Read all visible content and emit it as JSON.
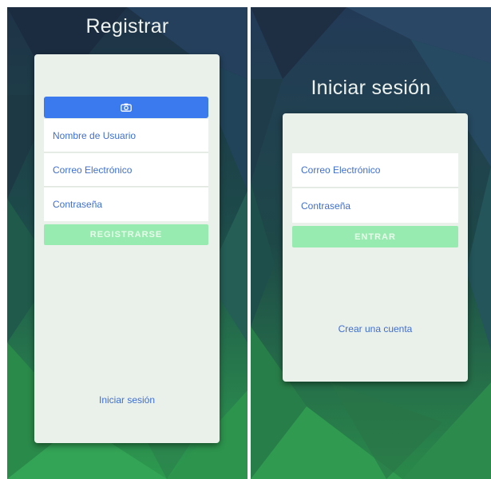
{
  "register_screen": {
    "title": "Registrar",
    "photo_button_icon": "camera-icon",
    "fields": [
      {
        "placeholder": "Nombre de Usuario"
      },
      {
        "placeholder": "Correo Electrónico"
      },
      {
        "placeholder": "Contraseña"
      }
    ],
    "submit_label": "REGISTRARSE",
    "link_label": "Iniciar sesión"
  },
  "login_screen": {
    "title": "Iniciar sesión",
    "fields": [
      {
        "placeholder": "Correo Electrónico"
      },
      {
        "placeholder": "Contraseña"
      }
    ],
    "submit_label": "ENTRAR",
    "link_label": "Crear una cuenta"
  },
  "colors": {
    "accent_blue": "#3b79ef",
    "button_green": "#98ebb0",
    "link_blue": "#3f6fcf",
    "card_background": "#eaf0ea"
  }
}
